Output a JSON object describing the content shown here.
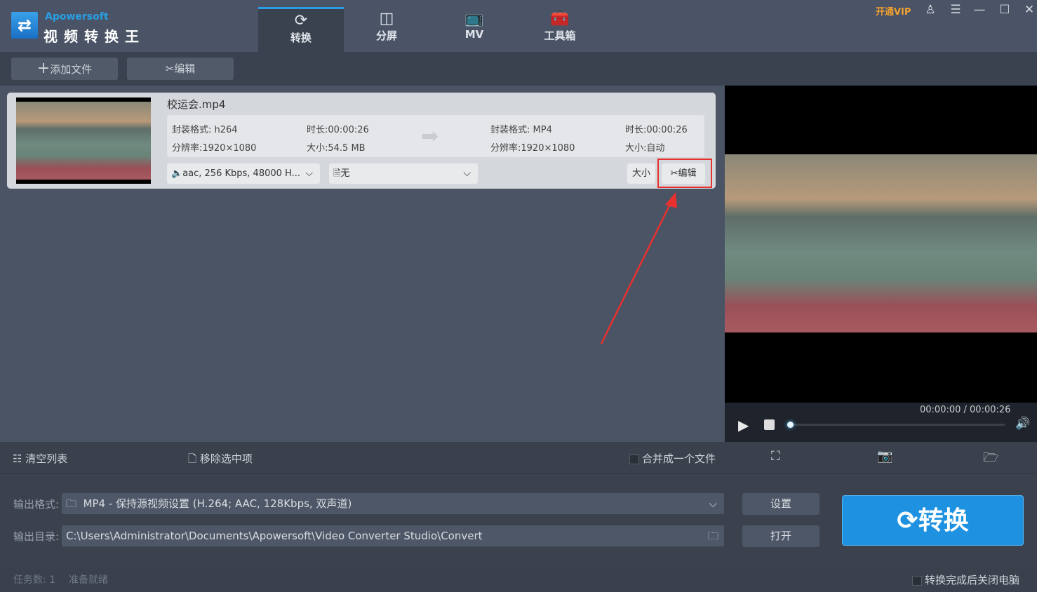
{
  "app": {
    "brand": "Apowersoft",
    "name": "视频转换王"
  },
  "tabs": [
    {
      "label": "转换",
      "icon": "refresh-icon"
    },
    {
      "label": "分屏",
      "icon": "split-screen-icon"
    },
    {
      "label": "MV",
      "icon": "tv-icon"
    },
    {
      "label": "工具箱",
      "icon": "toolbox-icon"
    }
  ],
  "window": {
    "vip": "开通VIP"
  },
  "toolbar": {
    "add_file": "添加文件",
    "edit": "编辑"
  },
  "file": {
    "name": "校运会.mp4",
    "source": {
      "format": "封装格式: h264",
      "duration": "时长:00:00:26",
      "resolution": "分辨率:1920×1080",
      "size": "大小:54.5 MB"
    },
    "target": {
      "format": "封装格式: MP4",
      "duration": "时长:00:00:26",
      "resolution": "分辨率:1920×1080",
      "size": "大小:自动"
    },
    "audio": "aac, 256 Kbps, 48000 H...",
    "subtitle": "无",
    "size_btn": "大小",
    "edit_btn": "编辑"
  },
  "player": {
    "time": "00:00:00 / 00:00:26",
    "progress": 0
  },
  "bottom": {
    "clear": "清空列表",
    "remove": "移除选中项",
    "merge": "合并成一个文件"
  },
  "output": {
    "format_label": "输出格式:",
    "format_value": "MP4 - 保持源视频设置 (H.264; AAC, 128Kbps, 双声道)",
    "dir_label": "输出目录:",
    "dir_value": "C:\\Users\\Administrator\\Documents\\Apowersoft\\Video Converter Studio\\Convert",
    "settings": "设置",
    "open": "打开",
    "convert": "转换"
  },
  "status": {
    "tasks": "任务数: 1",
    "state": "准备就绪",
    "shutdown": "转换完成后关闭电脑"
  },
  "colors": {
    "accent": "#1e92e0",
    "highlight": "#e8312f"
  }
}
